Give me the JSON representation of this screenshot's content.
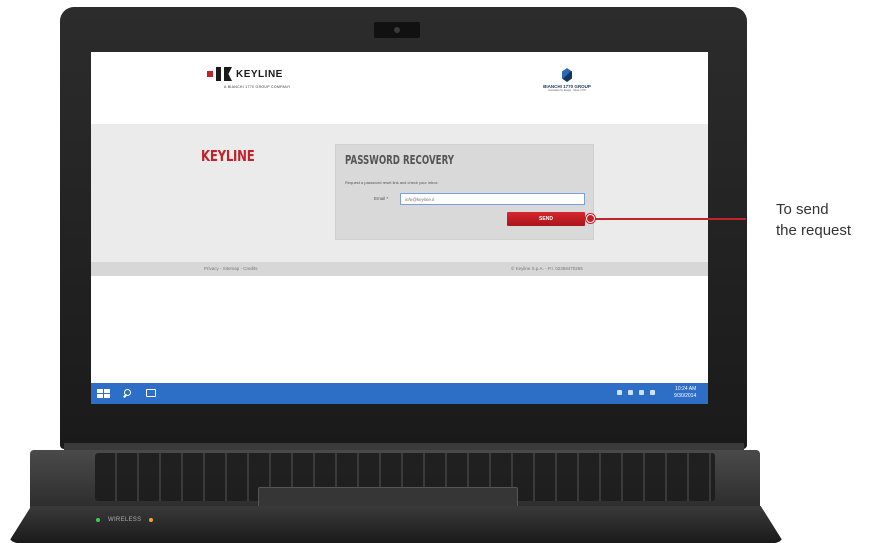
{
  "website": {
    "header": {
      "keyline_logo_word": "KEYLINE",
      "keyline_logo_sub": "A BIANCHI 1770 GROUP COMPANY",
      "bianchi_logo_word": "BIANCHI 1770 GROUP",
      "bianchi_logo_sub": "Innovation by design · Since 1770"
    },
    "brand_title": "KEYLINE",
    "recovery": {
      "title": "PASSWORD RECOVERY",
      "description": "Request a password reset link and check your inbox.",
      "email_label": "Email *",
      "email_placeholder": "info@keyline.it",
      "send_label": "SEND"
    },
    "footer": {
      "links": "Privacy - Sitemap - Credits",
      "copyright": "© Keyline S.p.A. - P.I. 02359470265"
    }
  },
  "taskbar": {
    "clock_time": "10:24 AM",
    "clock_date": "9/30/2014"
  },
  "laptop": {
    "wireless_label": "WIRELESS"
  },
  "annotation": {
    "line1": "To send",
    "line2": "the request"
  },
  "colors": {
    "brand_red": "#c0232b",
    "taskbar_blue": "#2d6fc7",
    "panel_grey": "#d9d9d9"
  },
  "icons": [
    "windows-start-icon",
    "search-icon",
    "task-view-icon",
    "webcam-icon"
  ]
}
